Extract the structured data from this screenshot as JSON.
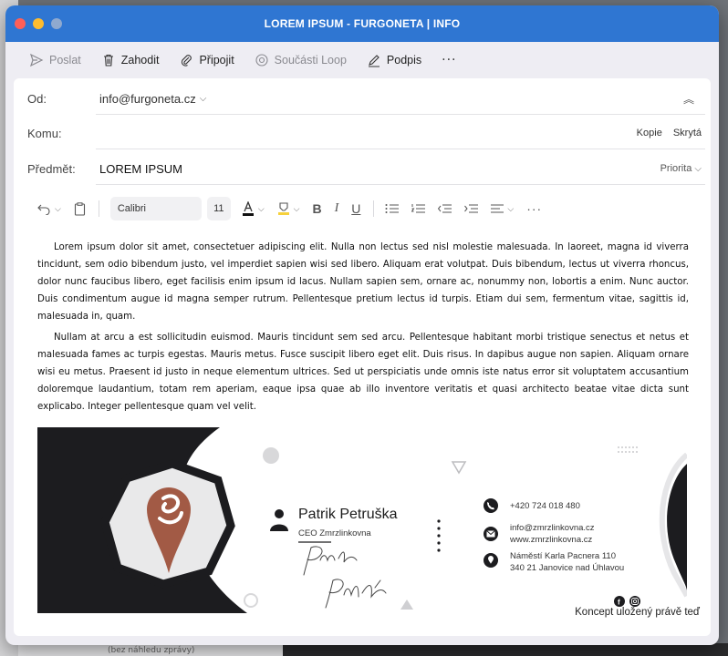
{
  "window": {
    "title": "LOREM IPSUM - FURGONETA | INFO"
  },
  "toolbar": {
    "send": "Poslat",
    "discard": "Zahodit",
    "attach": "Připojit",
    "loop": "Součásti Loop",
    "signature": "Podpis",
    "more": "···"
  },
  "fields": {
    "from_label": "Od:",
    "from_value": "info@furgoneta.cz",
    "to_label": "Komu:",
    "cc": "Kopie",
    "bcc": "Skrytá",
    "subject_label": "Předmět:",
    "subject_value": "LOREM IPSUM",
    "priority": "Priorita"
  },
  "format": {
    "font": "Calibri",
    "size": "11",
    "more": "···"
  },
  "body": {
    "p1": "Lorem ipsum dolor sit amet, consectetuer adipiscing elit. Nulla non lectus sed nisl molestie malesuada. In laoreet, magna id viverra tincidunt, sem odio bibendum justo, vel imperdiet sapien wisi sed libero. Aliquam erat volutpat. Duis bibendum, lectus ut viverra rhoncus, dolor nunc faucibus libero, eget facilisis enim ipsum id lacus. Nullam sapien sem, ornare ac, nonummy non, lobortis a enim. Nunc auctor. Duis condimentum augue id magna semper rutrum. Pellentesque pretium lectus id turpis. Etiam dui sem, fermentum vitae, sagittis id, malesuada in, quam.",
    "p2": "Nullam at arcu a est sollicitudin euismod. Mauris tincidunt sem sed arcu. Pellentesque habitant morbi tristique senectus et netus et malesuada fames ac turpis egestas. Mauris metus. Fusce suscipit libero eget elit. Duis risus. In dapibus augue non sapien. Aliquam ornare wisi eu metus. Praesent id justo in neque elementum ultrices. Sed ut perspiciatis unde omnis iste natus error sit voluptatem accusantium doloremque laudantium, totam rem aperiam, eaque ipsa quae ab illo inventore veritatis et quasi architecto beatae vitae dicta sunt explicabo. Integer pellentesque quam vel velit."
  },
  "signature": {
    "name": "Patrik Petruška",
    "role": "CEO Zmrzlinkovna",
    "phone": "+420 724 018 480",
    "email": "info@zmrzlinkovna.cz",
    "web": "www.zmrzlinkovna.cz",
    "address1": "Náměstí Karla Pacnera 110",
    "address2": "340 21 Janovice nad Úhlavou",
    "signature_script": "Petruška"
  },
  "status": {
    "draft_saved": "Koncept uložený právě teď"
  },
  "background": {
    "hint": "(bez náhledu zprávy)"
  },
  "colors": {
    "titlebar": "#2f76d2",
    "signature_dark": "#1c1c1f",
    "logo_brown": "#a25a45"
  }
}
